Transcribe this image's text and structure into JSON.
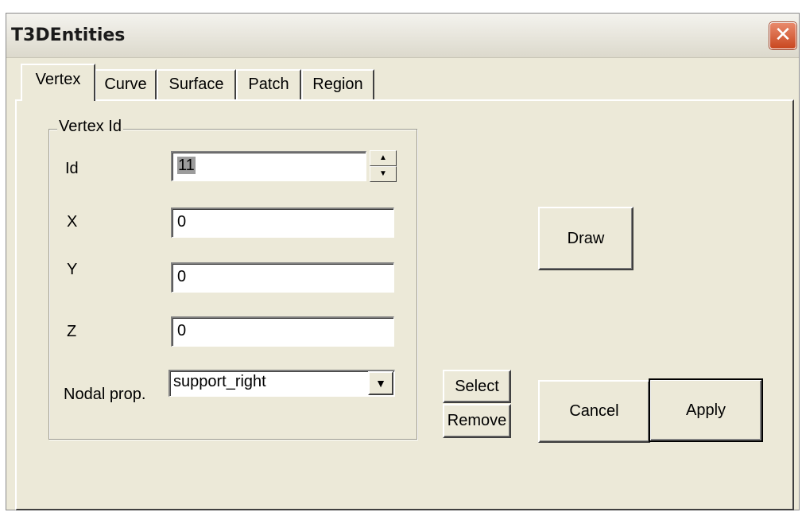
{
  "window": {
    "title": "T3DEntities",
    "close_glyph": "✕"
  },
  "tabs": [
    {
      "label": "Vertex",
      "active": true
    },
    {
      "label": "Curve"
    },
    {
      "label": "Surface"
    },
    {
      "label": "Patch"
    },
    {
      "label": "Region"
    }
  ],
  "vertex_group": {
    "title": "Vertex Id",
    "id": {
      "label": "Id",
      "value": "11"
    },
    "x": {
      "label": "X",
      "value": "0"
    },
    "y": {
      "label": "Y",
      "value": "0"
    },
    "z": {
      "label": "Z",
      "value": "0"
    },
    "nodal_prop": {
      "label": "Nodal prop.",
      "value": "support_right"
    }
  },
  "icons": {
    "spin_up": "▲",
    "spin_down": "▼",
    "dropdown": "▼"
  },
  "buttons": {
    "draw": "Draw",
    "select": "Select",
    "remove": "Remove",
    "cancel": "Cancel",
    "apply": "Apply"
  }
}
